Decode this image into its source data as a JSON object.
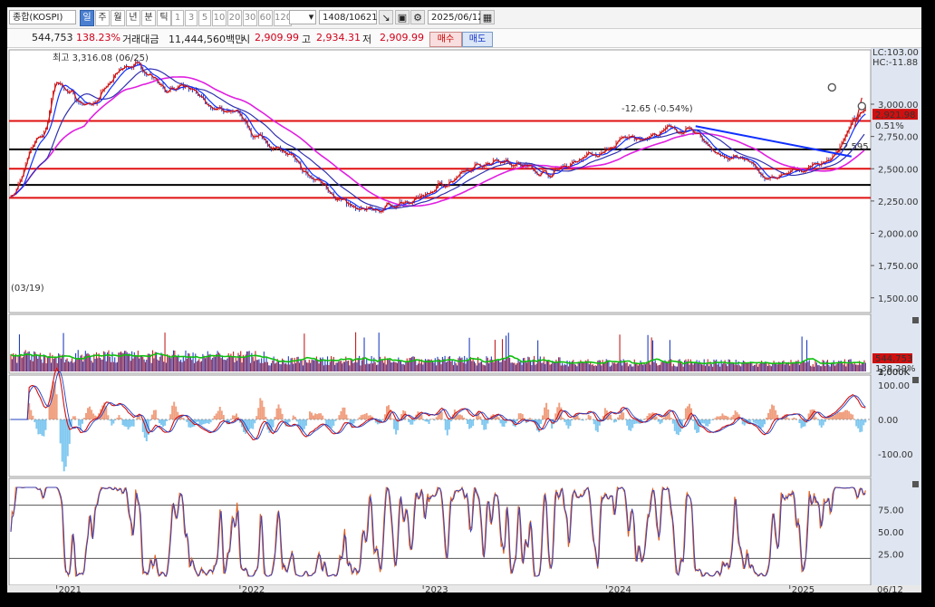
{
  "toolbar": {
    "symbol": "종합(KOSPI)",
    "periods": [
      "일",
      "주",
      "월",
      "년",
      "분",
      "틱"
    ],
    "active_period": "일",
    "intervals": [
      "1",
      "3",
      "5",
      "10",
      "20",
      "30",
      "60",
      "120"
    ],
    "bar_count": "1408/10621",
    "date": "2025/06/12",
    "icons": [
      "dropdown-icon",
      "chart-pattern-icon",
      "save-icon",
      "settings-icon",
      "calendar-icon"
    ]
  },
  "infobar": {
    "volume": "544,753",
    "volume_pct": "138.23%",
    "trade_value_label": "거래대금",
    "trade_value": "11,444,560백만",
    "open_label": "시",
    "open": "2,909.99",
    "high_label": "고",
    "high": "2,934.31",
    "low_label": "저",
    "low": "2,909.99",
    "buy_label": "매수",
    "sell_label": "매도"
  },
  "main_chart": {
    "high_annotation": "최고 3,316.08 (06/25)",
    "low_annotation": "(03/19)",
    "lc": "LC:103.00",
    "hc": "HC:-11.88",
    "trendline_label": "-12.65 (-0.54%)",
    "trendline_value": "2,595",
    "current_price": "2,921.98",
    "current_change": "0.51%",
    "y_ticks": [
      "3,000.00",
      "2,750.00",
      "2,500.00",
      "2,250.00",
      "2,000.00",
      "1,750.00",
      "1,500.00"
    ]
  },
  "volume_panel": {
    "y_ticks": [
      "3,000K",
      "2,000K",
      "1,000K"
    ],
    "current": "544,753",
    "current_pct": "138.29%"
  },
  "macd_panel": {
    "y_ticks": [
      "100.00",
      "0.00",
      "-100.00"
    ]
  },
  "stoch_panel": {
    "y_ticks": [
      "75.00",
      "50.00",
      "25.00"
    ]
  },
  "x_axis": {
    "labels": [
      "2021",
      "2022",
      "2023",
      "2024",
      "2025"
    ],
    "end_label": "06/12"
  },
  "chart_data": {
    "type": "line",
    "title": "종합(KOSPI)",
    "x": [
      "2020-10",
      "2020-12",
      "2021-01",
      "2021-03",
      "2021-06",
      "2021-09",
      "2021-12",
      "2022-03",
      "2022-06",
      "2022-09",
      "2022-12",
      "2023-03",
      "2023-06",
      "2023-09",
      "2023-12",
      "2024-03",
      "2024-06",
      "2024-09",
      "2024-12",
      "2025-03",
      "2025-06"
    ],
    "series": [
      {
        "name": "종합(KOSPI)",
        "values": [
          2300,
          2750,
          3150,
          3000,
          3300,
          3100,
          2950,
          2700,
          2400,
          2160,
          2240,
          2420,
          2590,
          2470,
          2610,
          2740,
          2800,
          2590,
          2420,
          2540,
          2922
        ]
      }
    ],
    "ylim": [
      1400,
      3400
    ],
    "horizontal_levels": [
      2870,
      2650,
      2500,
      2375,
      2275
    ],
    "annotations": [
      "최고 3,316.08 (06/25)",
      "(03/19)"
    ],
    "grid": false
  }
}
